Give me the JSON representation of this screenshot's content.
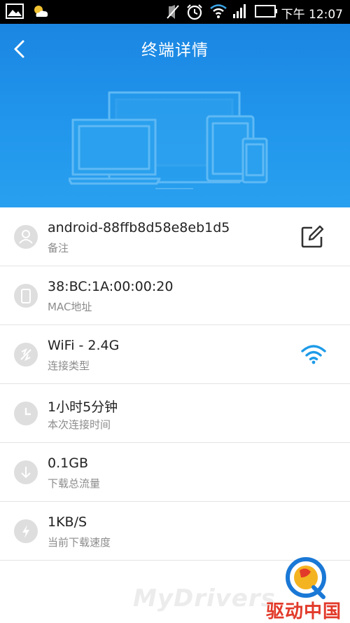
{
  "status_bar": {
    "time": "下午 12:07",
    "icons": [
      "image-icon",
      "weather-icon",
      "mute-icon",
      "alarm-icon",
      "wifi-icon",
      "signal-icon",
      "battery-icon"
    ]
  },
  "header": {
    "title": "终端详情",
    "back_icon": "chevron-left-icon",
    "illustration": "devices-illustration"
  },
  "details": [
    {
      "value": "android-88ffb8d58e8eb1d5",
      "label": "备注",
      "icon": "person-icon",
      "action_icon": "edit-icon"
    },
    {
      "value": "38:BC:1A:00:00:20",
      "label": "MAC地址",
      "icon": "phone-icon"
    },
    {
      "value": "WiFi - 2.4G",
      "label": "连接类型",
      "icon": "connection-icon",
      "status_icon": "wifi-icon"
    },
    {
      "value": "1小时5分钟",
      "label": "本次连接时间",
      "icon": "clock-icon"
    },
    {
      "value": "0.1GB",
      "label": "下载总流量",
      "icon": "download-icon"
    },
    {
      "value": "1KB/S",
      "label": "当前下载速度",
      "icon": "speed-icon"
    }
  ],
  "watermark": {
    "text": "MyDrivers",
    "brand": "驱动中国"
  },
  "colors": {
    "header_blue": "#2196ec",
    "wifi_blue": "#1e9be8",
    "icon_gray": "#dedede",
    "brand_red": "#e23a2a"
  }
}
